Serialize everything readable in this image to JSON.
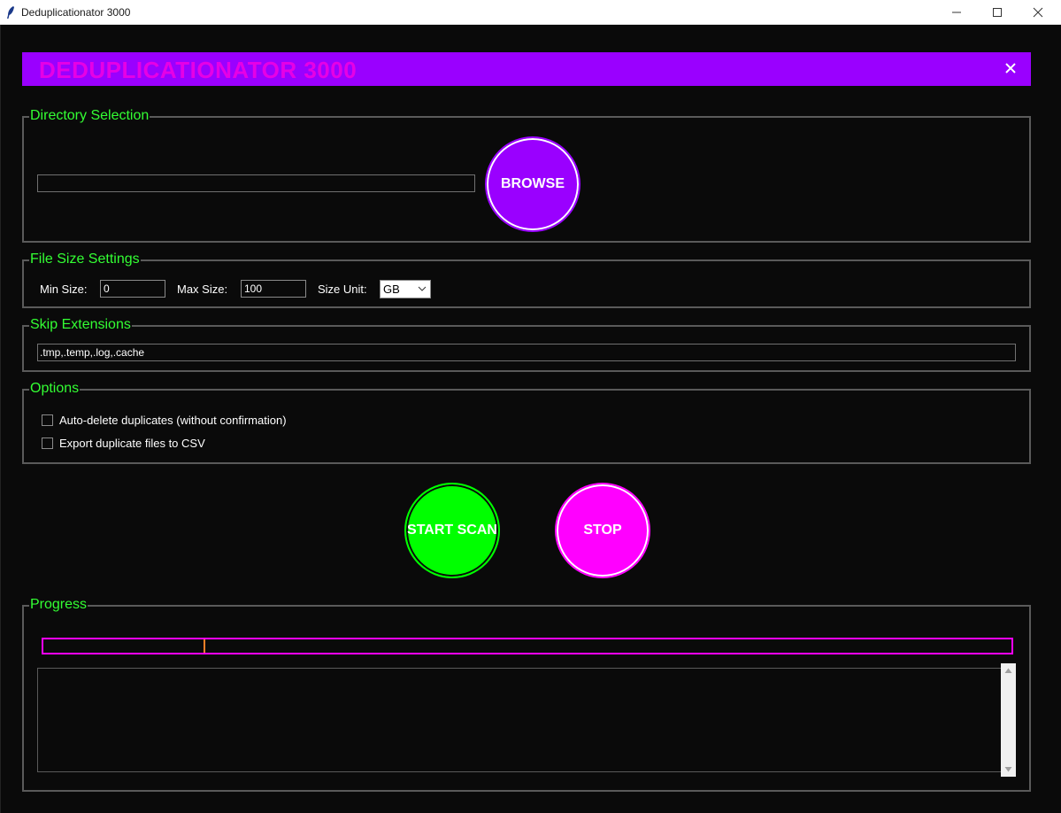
{
  "window": {
    "title": "Deduplicationator 3000",
    "icons": [
      "feather-icon",
      "minimize-icon",
      "maximize-icon",
      "close-icon"
    ]
  },
  "banner": {
    "title": "DEDUPLICATIONATOR 3000",
    "close_label": "✕",
    "background_color": "#9a00ff",
    "title_color": "#e600e6"
  },
  "directory": {
    "group_label": "Directory Selection",
    "path_value": "",
    "browse_label": "BROWSE"
  },
  "file_size": {
    "group_label": "File Size Settings",
    "min_label": "Min Size:",
    "min_value": "0",
    "max_label": "Max Size:",
    "max_value": "100",
    "unit_label": "Size Unit:",
    "unit_value": "GB"
  },
  "skip": {
    "group_label": "Skip Extensions",
    "value": ".tmp,.temp,.log,.cache"
  },
  "options": {
    "group_label": "Options",
    "items": [
      {
        "label": "Auto-delete duplicates (without confirmation)",
        "checked": false
      },
      {
        "label": "Export duplicate files to CSV",
        "checked": false
      }
    ]
  },
  "actions": {
    "start_label": "START SCAN",
    "stop_label": "STOP",
    "start_color": "#00ff00",
    "stop_color": "#ff00ff"
  },
  "progress": {
    "group_label": "Progress",
    "value_percent": 0,
    "bar_color": "#ff00ff",
    "log_text": ""
  },
  "theme": {
    "label_color": "#33ff33",
    "background": "#0a0a0a"
  }
}
